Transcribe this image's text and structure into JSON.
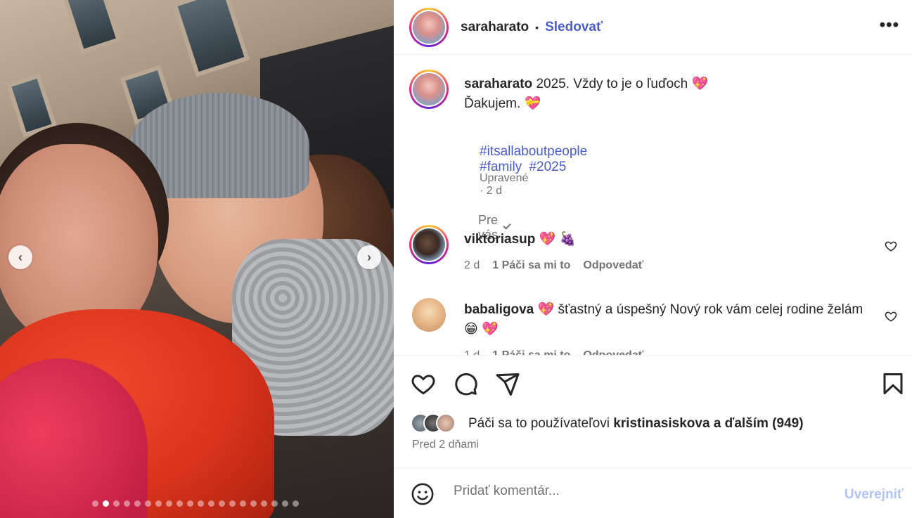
{
  "post": {
    "username": "saraharato",
    "separator": "•",
    "follow_label": "Sledovať",
    "more_label": "•••",
    "caption_text": "2025. Vždy to je o ľuďoch",
    "caption_line2": "Ďakujem.",
    "hashtags": [
      "#itsallaboutpeople",
      "#family",
      "#2025"
    ],
    "caption_meta": "Upravené · 2 d",
    "for_you_label": "Pre vás"
  },
  "comments": [
    {
      "username": "viktoriasup",
      "text": "",
      "time": "2 d",
      "likes": "1 Páči sa mi to",
      "reply": "Odpovedať"
    },
    {
      "username": "babaligova",
      "text": "šťastný a úspešný Nový rok vám celej rodine želám",
      "time": "1 d",
      "likes": "1 Páči sa mi to",
      "reply": "Odpovedať"
    }
  ],
  "media": {
    "prev_label": "‹",
    "next_label": "›",
    "slide_count": 20,
    "active_slide": 1
  },
  "likes": {
    "prefix": "Páči sa to používateľovi",
    "user": "kristinasiskova",
    "suffix": "a ďalším (949)",
    "time_ago": "Pred 2 dňami"
  },
  "composer": {
    "placeholder": "Pridať komentár...",
    "post_label": "Uverejniť"
  },
  "icons": [
    "smile-icon",
    "heart-icon",
    "comment-icon",
    "share-icon",
    "bookmark-icon",
    "more-icon"
  ],
  "colors": {
    "link": "#4a5cc8",
    "muted": "#737373",
    "heart": "#e8305b",
    "post_disabled": "#b2c3f5"
  }
}
